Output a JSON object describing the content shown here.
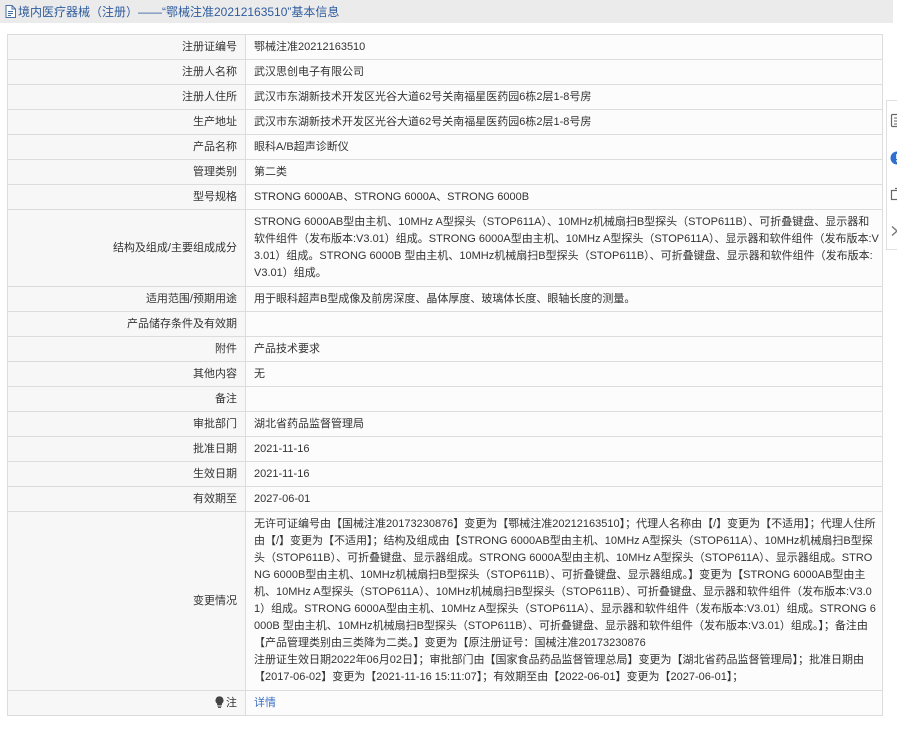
{
  "header": {
    "icon": "document-icon",
    "title": "境内医疗器械（注册）——“鄂械注准20212163510”基本信息"
  },
  "rows": [
    {
      "label": "注册证编号",
      "value": "鄂械注准20212163510"
    },
    {
      "label": "注册人名称",
      "value": "武汉思创电子有限公司"
    },
    {
      "label": "注册人住所",
      "value": "武汉市东湖新技术开发区光谷大道62号关南福星医药园6栋2层1-8号房"
    },
    {
      "label": "生产地址",
      "value": "武汉市东湖新技术开发区光谷大道62号关南福星医药园6栋2层1-8号房"
    },
    {
      "label": "产品名称",
      "value": "眼科A/B超声诊断仪"
    },
    {
      "label": "管理类别",
      "value": "第二类"
    },
    {
      "label": "型号规格",
      "value": "STRONG 6000AB、STRONG 6000A、STRONG 6000B"
    },
    {
      "label": "结构及组成/主要组成成分",
      "value": "STRONG 6000AB型由主机、10MHz A型探头（STOP611A）、10MHz机械扇扫B型探头（STOP611B）、可折叠键盘、显示器和软件组件（发布版本:V3.01）组成。STRONG 6000A型由主机、10MHz A型探头（STOP611A）、显示器和软件组件（发布版本:V3.01）组成。STRONG 6000B 型由主机、10MHz机械扇扫B型探头（STOP611B）、可折叠键盘、显示器和软件组件（发布版本:V3.01）组成。"
    },
    {
      "label": "适用范围/预期用途",
      "value": "用于眼科超声B型成像及前房深度、晶体厚度、玻璃体长度、眼轴长度的测量。"
    },
    {
      "label": "产品储存条件及有效期",
      "value": ""
    },
    {
      "label": "附件",
      "value": "产品技术要求"
    },
    {
      "label": "其他内容",
      "value": "无"
    },
    {
      "label": "备注",
      "value": ""
    },
    {
      "label": "审批部门",
      "value": "湖北省药品监督管理局"
    },
    {
      "label": "批准日期",
      "value": "2021-11-16"
    },
    {
      "label": "生效日期",
      "value": "2021-11-16"
    },
    {
      "label": "有效期至",
      "value": "2027-06-01"
    },
    {
      "label": "变更情况",
      "value": "无许可证编号由【国械注准20173230876】变更为【鄂械注准20212163510】；代理人名称由【/】变更为【不适用】；代理人住所由【/】变更为【不适用】；结构及组成由【STRONG 6000AB型由主机、10MHz A型探头（STOP611A）、10MHz机械扇扫B型探头（STOP611B）、可折叠键盘、显示器组成。STRONG 6000A型由主机、10MHz A型探头（STOP611A）、显示器组成。STRONG 6000B型由主机、10MHz机械扇扫B型探头（STOP611B）、可折叠键盘、显示器组成。】变更为【STRONG 6000AB型由主机、10MHz A型探头（STOP611A）、10MHz机械扇扫B型探头（STOP611B）、可折叠键盘、显示器和软件组件（发布版本:V3.01）组成。STRONG 6000A型由主机、10MHz A型探头（STOP611A）、显示器和软件组件（发布版本:V3.01）组成。STRONG 6000B 型由主机、10MHz机械扇扫B型探头（STOP611B）、可折叠键盘、显示器和软件组件（发布版本:V3.01）组成。】；备注由【产品管理类别由三类降为二类。】变更为【原注册证号：国械注准20173230876\n注册证生效日期2022年06月02日】；审批部门由【国家食品药品监督管理总局】变更为【湖北省药品监督管理局】；批准日期由【2017-06-02】变更为【2021-11-16 15:11:07】；有效期至由【2022-06-01】变更为【2027-06-01】；"
    }
  ],
  "note": {
    "icon": "bulb-icon",
    "label": "注",
    "link_text": "详情"
  },
  "side_toolbar": {
    "icons": [
      "document-icon",
      "info-icon",
      "share-icon",
      "chevron-right-icon"
    ]
  },
  "colors": {
    "title": "#2f5c9e",
    "link": "#3a6fc4",
    "header_bg": "#ebebeb",
    "border": "#dcdcdc",
    "label_bg": "#f7f7f7",
    "accent_blue": "#2f6fd0"
  }
}
